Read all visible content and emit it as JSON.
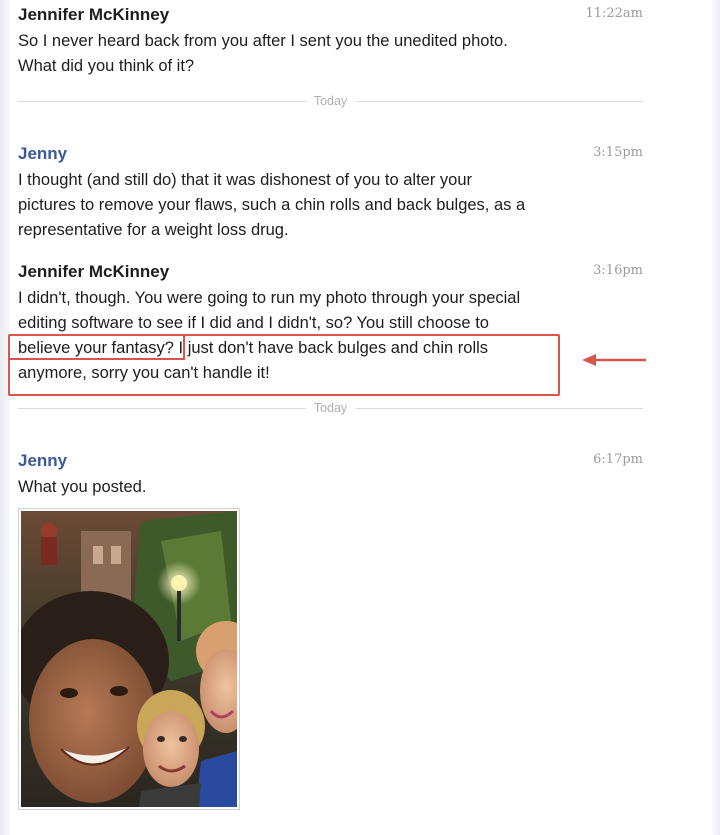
{
  "messages": [
    {
      "sender": "Jennifer McKinney",
      "time": "11:22am",
      "lines": [
        "So I never heard back from you after I sent you the unedited photo.",
        "What did you think of it?"
      ]
    },
    {
      "sender": "Jenny",
      "time": "3:15pm",
      "lines": [
        "I thought (and still do) that it was dishonest of you to alter your",
        "pictures to remove your flaws, such a chin rolls and back bulges, as a",
        "representative for a weight loss drug."
      ]
    },
    {
      "sender": "Jennifer McKinney",
      "time": "3:16pm",
      "lines": [
        "I didn't, though. You were going to run my photo through your special",
        "editing software to see if I did and I didn't, so? You still choose to"
      ],
      "line3_before": "believe your fantasy?",
      "line3_after": " I just don't have back bulges and chin rolls",
      "line4": "anymore, sorry you can't handle it!"
    },
    {
      "sender": "Jenny",
      "time": "6:17pm",
      "lines": [
        "What you posted."
      ]
    }
  ],
  "dividers": {
    "first": "Today",
    "second": "Today"
  },
  "annotation": {
    "box_color": "#d9534f",
    "arrow_color": "#d9534f"
  },
  "icons": {
    "arrow": "left-arrow-icon"
  }
}
